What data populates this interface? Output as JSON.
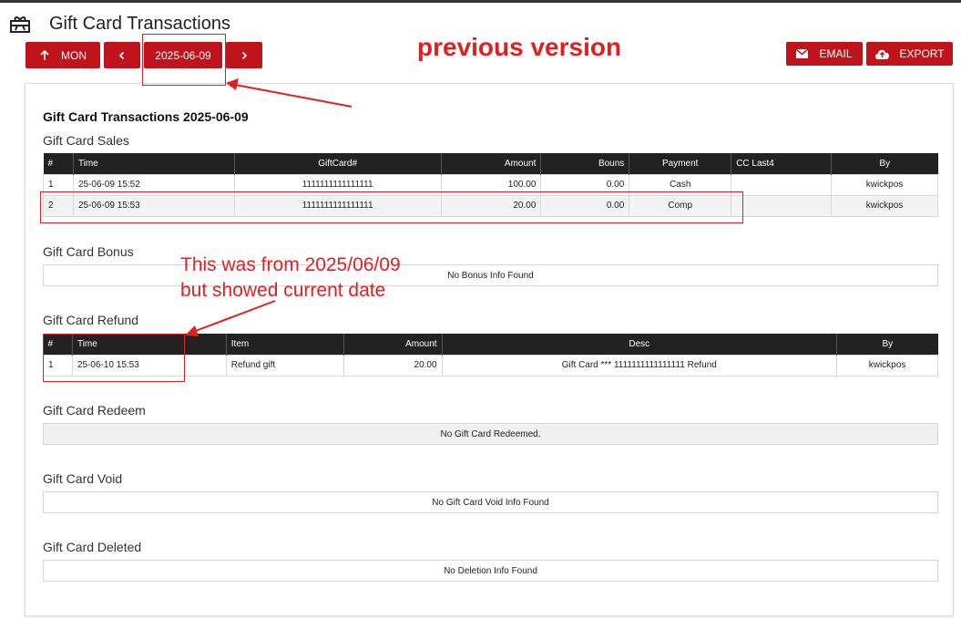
{
  "header": {
    "title": "Gift Card Transactions"
  },
  "toolbar": {
    "mon_label": "MON",
    "date_label": "2025-06-09",
    "email_label": "EMAIL",
    "export_label": "EXPORT"
  },
  "report": {
    "heading": "Gift Card Transactions 2025-06-09"
  },
  "sales": {
    "title": "Gift Card Sales",
    "columns": [
      "#",
      "Time",
      "GiftCard#",
      "Amount",
      "Bouns",
      "Payment",
      "CC Last4",
      "By"
    ],
    "rows": [
      [
        "1",
        "25-06-09 15:52",
        "1111111111111111",
        "100.00",
        "0.00",
        "Cash",
        "",
        "kwickpos"
      ],
      [
        "2",
        "25-06-09 15:53",
        "1111111111111111",
        "20.00",
        "0.00",
        "Comp",
        "",
        "kwickpos"
      ]
    ]
  },
  "bonus": {
    "title": "Gift Card Bonus",
    "empty": "No Bonus Info Found"
  },
  "refund": {
    "title": "Gift Card Refund",
    "columns": [
      "#",
      "Time",
      "Item",
      "Amount",
      "Desc",
      "By"
    ],
    "rows": [
      [
        "1",
        "25-06-10 15:53",
        "Refund gift",
        "20.00",
        "Gift Card *** 1111111111111111 Refund",
        "kwickpos"
      ]
    ]
  },
  "redeem": {
    "title": "Gift Card Redeem",
    "empty": "No Gift Card Redeemed."
  },
  "void": {
    "title": "Gift Card Void",
    "empty": "No Gift Card Void Info Found"
  },
  "deleted": {
    "title": "Gift Card Deleted",
    "empty": "No Deletion Info Found"
  },
  "annotations": {
    "previous_version": "previous version",
    "note_line1": "This was from 2025/06/09",
    "note_line2": "but showed current date"
  },
  "colors": {
    "accent": "#c0141c",
    "header_bg": "#222222",
    "annotation": "#e02020"
  }
}
